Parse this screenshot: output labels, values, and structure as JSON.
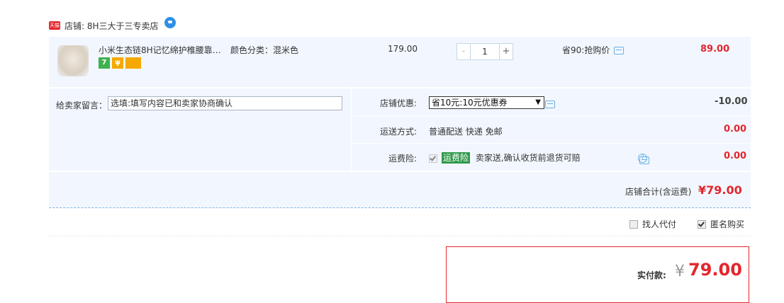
{
  "shop": {
    "badge": "天猫",
    "label": "店铺: 8H三大于三专卖店"
  },
  "item": {
    "title": "小米生态链8H记忆绵护椎腰靠…",
    "sku": "颜色分类：混米色",
    "badges": [
      "7",
      "ψ",
      ""
    ],
    "unit_price": "179.00",
    "quantity": {
      "minus": "-",
      "value": "1",
      "plus": "+"
    },
    "promo": "省90:抢购价",
    "total": "89.00"
  },
  "options": {
    "message_label": "给卖家留言：",
    "message_placeholder": "选填:填写内容已和卖家协商确认",
    "coupon": {
      "label": "店铺优惠:",
      "selected": "省10元:10元优惠券",
      "amount": "-10.00"
    },
    "shipping": {
      "label": "运送方式:",
      "value": "普通配送 快递 免邮",
      "amount": "0.00"
    },
    "insurance": {
      "label": "运费险:",
      "tag": "运费险",
      "value": "卖家送,确认收货前退货可赔",
      "amount": "0.00"
    }
  },
  "subtotal": {
    "label": "店铺合计(含运费)",
    "value": "¥79.00"
  },
  "payment": {
    "proxy_pay": "找人代付",
    "anonymous": "匿名购买"
  },
  "final": {
    "label": "实付款:",
    "currency": "¥",
    "value": "79.00"
  },
  "colors": {
    "accent": "#e4262d",
    "panel_bg": "#f2f7ff",
    "link": "#6ab0e6"
  }
}
